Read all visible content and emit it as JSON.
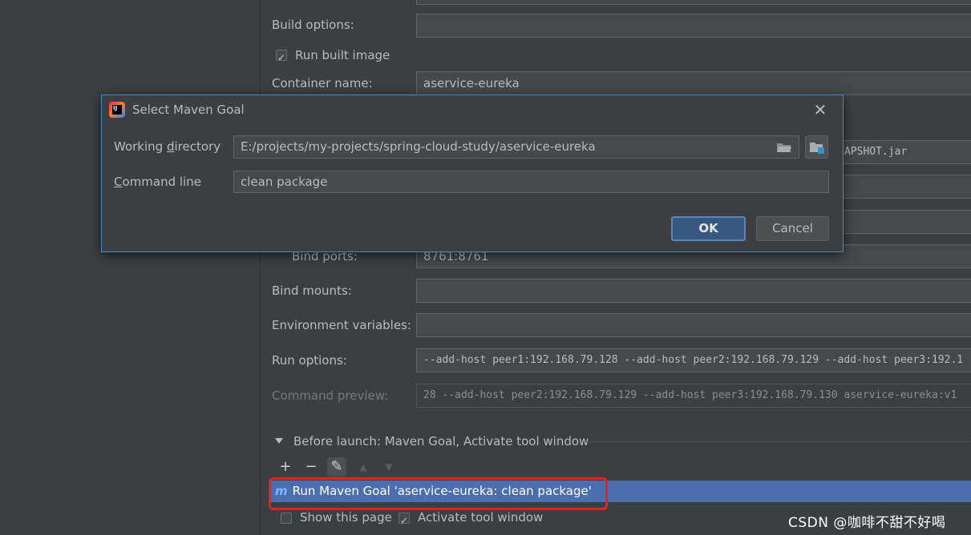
{
  "settings": {
    "build_options_label": "Build options:",
    "build_options_value": "",
    "run_built_image_label": "Run built image",
    "run_built_image_checked": true,
    "container_name_label": "Container name:",
    "container_name_value": "aservice-eureka",
    "jar_value_partial": "APSHOT.jar",
    "bind_ports_label": "Bind ports:",
    "bind_ports_value": "8761:8761",
    "bind_mounts_label": "Bind mounts:",
    "bind_mounts_value": "",
    "env_vars_label": "Environment variables:",
    "env_vars_value": "",
    "run_options_label": "Run options:",
    "run_options_value": "--add-host peer1:192.168.79.128 --add-host peer2:192.168.79.129 --add-host peer3:192.1",
    "command_preview_label": "Command preview:",
    "command_preview_value": "28 --add-host peer2:192.168.79.129 --add-host peer3:192.168.79.130 aservice-eureka:v1"
  },
  "before_launch": {
    "header_label": "Before launch: Maven Goal, Activate tool window",
    "toolbar": {
      "add": "+",
      "remove": "−",
      "edit": "✎",
      "up": "▲",
      "down": "▼"
    },
    "items": [
      {
        "label": "Run Maven Goal 'aservice-eureka: clean package'"
      }
    ],
    "show_this_page_label": "Show this page",
    "show_this_page_checked": false,
    "activate_tool_window_label": "Activate tool window",
    "activate_tool_window_checked": true
  },
  "dialog": {
    "title": "Select Maven Goal",
    "app_icon_text": "IJ",
    "working_directory_label_pre": "Working ",
    "working_directory_label_mnemonic": "d",
    "working_directory_label_post": "irectory",
    "working_directory_value": "E:/projects/my-projects/spring-cloud-study/aservice-eureka",
    "command_line_label_mnemonic": "C",
    "command_line_label_post": "ommand line",
    "command_line_value": "clean package",
    "ok_label": "OK",
    "cancel_label": "Cancel"
  },
  "watermark": "CSDN @咖啡不甜不好喝",
  "colors": {
    "background": "#3c3f41",
    "field_bg": "#45494a",
    "selection": "#4b6eaf",
    "dialog_border": "#4a88c7",
    "ok_button": "#365880",
    "highlight_box": "#e82020"
  }
}
